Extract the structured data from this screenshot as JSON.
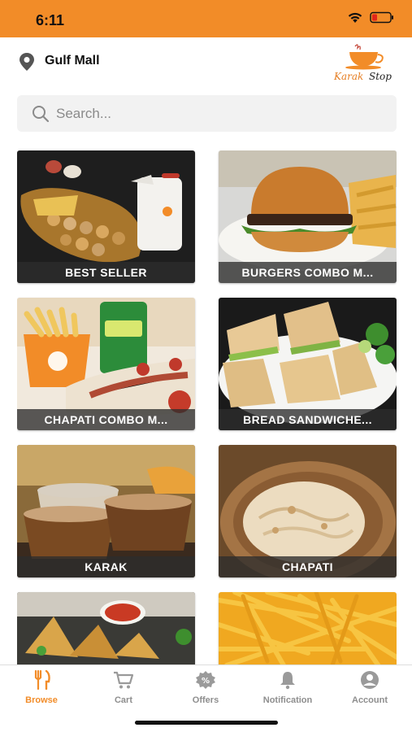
{
  "status_bar": {
    "time": "6:11",
    "background": "#f28c28"
  },
  "header": {
    "location": "Gulf Mall",
    "location_icon": "location-pin-icon",
    "brand": {
      "line1": "Karak",
      "line2": "Stop"
    }
  },
  "search": {
    "placeholder": "Search...",
    "value": ""
  },
  "categories": [
    {
      "label": "BEST SELLER"
    },
    {
      "label": "BURGERS COMBO M..."
    },
    {
      "label": "CHAPATI COMBO M..."
    },
    {
      "label": "BREAD SANDWICHE..."
    },
    {
      "label": "KARAK"
    },
    {
      "label": "CHAPATI"
    },
    {
      "label": ""
    },
    {
      "label": ""
    }
  ],
  "tabs": [
    {
      "label": "Browse",
      "icon": "fork-knife-icon",
      "active": true
    },
    {
      "label": "Cart",
      "icon": "cart-icon"
    },
    {
      "label": "Offers",
      "icon": "offer-badge-icon"
    },
    {
      "label": "Notification",
      "icon": "bell-icon"
    },
    {
      "label": "Account",
      "icon": "user-icon"
    }
  ],
  "colors": {
    "accent": "#f28c28",
    "inactive": "#8e8e8e",
    "label_overlay": "#2d2d2d"
  }
}
